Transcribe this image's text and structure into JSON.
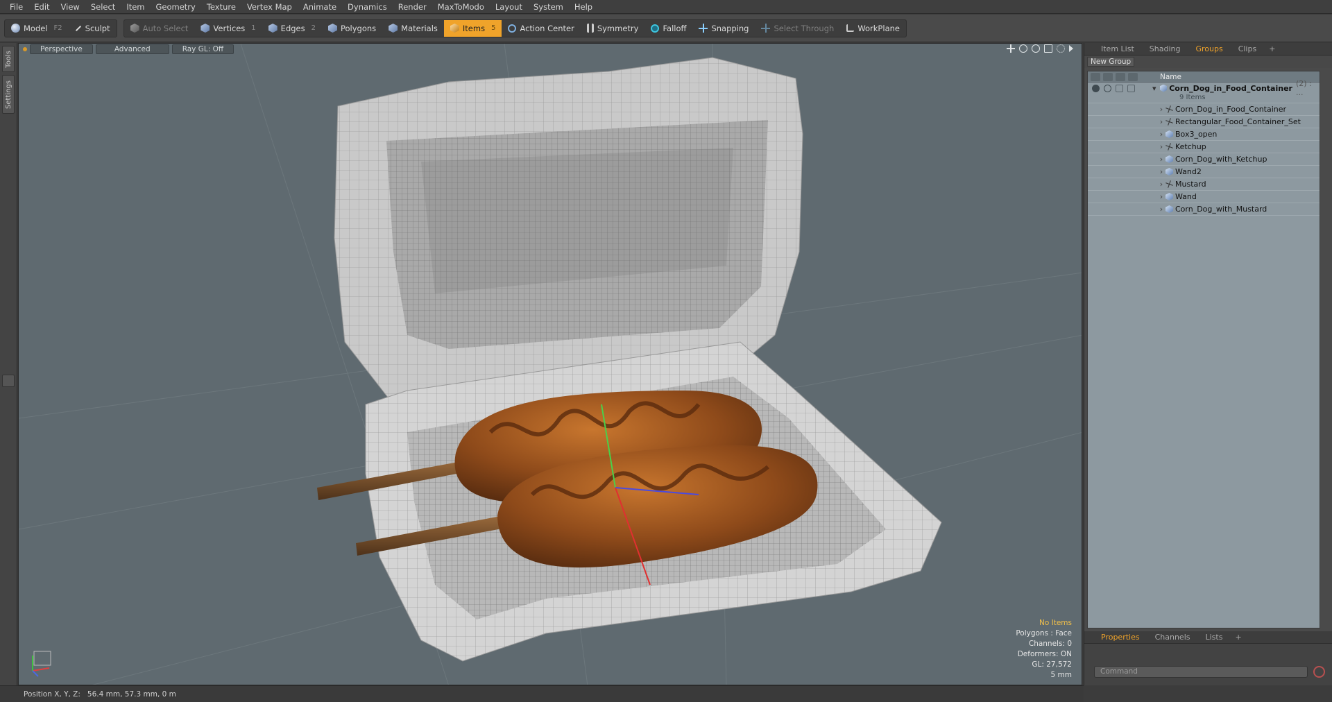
{
  "menu": [
    "File",
    "Edit",
    "View",
    "Select",
    "Item",
    "Geometry",
    "Texture",
    "Vertex Map",
    "Animate",
    "Dynamics",
    "Render",
    "MaxToModo",
    "Layout",
    "System",
    "Help"
  ],
  "toolbar": {
    "model": "Model",
    "model_key": "F2",
    "sculpt": "Sculpt",
    "auto_select": "Auto Select",
    "vertices": "Vertices",
    "vertices_key": "1",
    "edges": "Edges",
    "edges_key": "2",
    "polygons": "Polygons",
    "materials": "Materials",
    "items": "Items",
    "items_key": "5",
    "action_center": "Action Center",
    "symmetry": "Symmetry",
    "falloff": "Falloff",
    "snapping": "Snapping",
    "select_through": "Select Through",
    "workplane": "WorkPlane"
  },
  "left_tabs": [
    "Tools",
    "Settings"
  ],
  "viewport": {
    "tabs": [
      "Perspective",
      "Advanced",
      "Ray GL: Off"
    ],
    "hud": [
      "No Items",
      "Polygons : Face",
      "Channels: 0",
      "Deformers: ON",
      "GL: 27,572",
      "5 mm"
    ]
  },
  "right_panel": {
    "tabs": [
      "Item List",
      "Shading",
      "Groups",
      "Clips"
    ],
    "active_tab": "Groups",
    "new_group": "New Group",
    "column_name": "Name",
    "root": {
      "name": "Corn_Dog_in_Food_Container",
      "count": "(2) : ...",
      "sub": "9 Items"
    },
    "items": [
      {
        "name": "Corn_Dog_in_Food_Container",
        "icon": "locator"
      },
      {
        "name": "Rectangular_Food_Container_Set",
        "icon": "locator"
      },
      {
        "name": "Box3_open",
        "icon": "mesh"
      },
      {
        "name": "Ketchup",
        "icon": "locator"
      },
      {
        "name": "Corn_Dog_with_Ketchup",
        "icon": "mesh"
      },
      {
        "name": "Wand2",
        "icon": "mesh"
      },
      {
        "name": "Mustard",
        "icon": "locator"
      },
      {
        "name": "Wand",
        "icon": "mesh"
      },
      {
        "name": "Corn_Dog_with_Mustard",
        "icon": "mesh"
      }
    ],
    "bottom_tabs": [
      "Properties",
      "Channels",
      "Lists"
    ],
    "command_placeholder": "Command"
  },
  "status": {
    "label": "Position X, Y, Z:",
    "value": "56.4 mm, 57.3 mm, 0 m"
  },
  "colors": {
    "accent": "#f0a32a",
    "viewport_bg": "#5f6a70"
  }
}
